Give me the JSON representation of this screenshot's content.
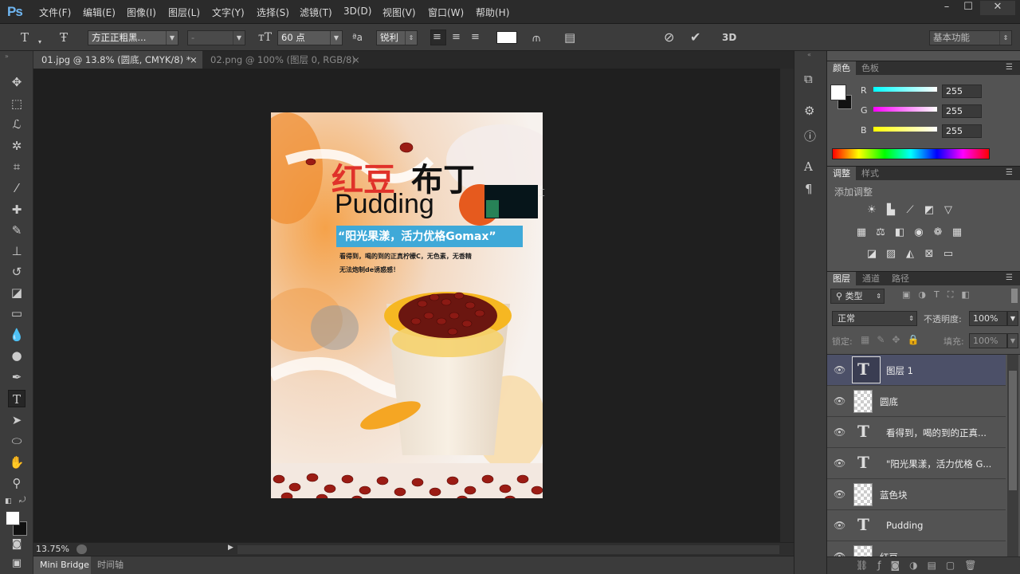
{
  "app": {
    "logo": "Ps"
  },
  "menu": [
    "文件(F)",
    "编辑(E)",
    "图像(I)",
    "图层(L)",
    "文字(Y)",
    "选择(S)",
    "滤镜(T)",
    "3D(D)",
    "视图(V)",
    "窗口(W)",
    "帮助(H)"
  ],
  "window_buttons": [
    "–",
    "☐",
    "✕"
  ],
  "options": {
    "font_family": "方正正粗黑...",
    "font_style": "-",
    "font_size": "60 点",
    "aa_label": "ªa",
    "antialias": "锐利",
    "three_d": "3D",
    "workspace": "基本功能"
  },
  "tabs": [
    {
      "label": "01.jpg @ 13.8% (圆底, CMYK/8) *",
      "close": "×",
      "active": true
    },
    {
      "label": "02.png @ 100% (图层 0, RGB/8)",
      "close": "×",
      "active": false
    }
  ],
  "status": {
    "zoom": "13.75%"
  },
  "bottom_tabs": [
    "Mini Bridge",
    "时间轴"
  ],
  "poster": {
    "title_red": "红豆",
    "title_black": "布丁",
    "subtitle": "Pudding",
    "slogan": "“阳光果漾，活力优格Gomax”",
    "line1": "看得到，喝的到的正真柠檬C，无色素，无香精",
    "line2": "无法炮制de诱惑感！"
  },
  "color_panel": {
    "tabs": [
      "颜色",
      "色板"
    ],
    "channels": [
      {
        "label": "R",
        "value": "255"
      },
      {
        "label": "G",
        "value": "255"
      },
      {
        "label": "B",
        "value": "255"
      }
    ]
  },
  "adjust_panel": {
    "tabs": [
      "调整",
      "样式"
    ],
    "add_label": "添加调整"
  },
  "layers_panel": {
    "tabs": [
      "图层",
      "通道",
      "路径"
    ],
    "filter_type": "类型",
    "blend_mode": "正常",
    "opacity_label": "不透明度:",
    "opacity": "100%",
    "lock_label": "锁定:",
    "fill_label": "填充:",
    "fill": "100%",
    "layers": [
      {
        "name": "图层 1",
        "type": "text",
        "selected": true
      },
      {
        "name": "圆底",
        "type": "pixel",
        "selected": false
      },
      {
        "name": "看得到，喝的到的正真...",
        "type": "text",
        "selected": false
      },
      {
        "name": "\"阳光果漾，活力优格 G...",
        "type": "text",
        "selected": false
      },
      {
        "name": "蓝色块",
        "type": "pixel",
        "selected": false
      },
      {
        "name": "Pudding",
        "type": "text",
        "selected": false
      },
      {
        "name": "红豆",
        "type": "pixel",
        "selected": false
      }
    ]
  },
  "colors": {
    "accent_blue": "#3fa9d8",
    "bean_red": "#8b1a14",
    "title_red": "#e0322a",
    "selected_layer": "#4c5068"
  }
}
